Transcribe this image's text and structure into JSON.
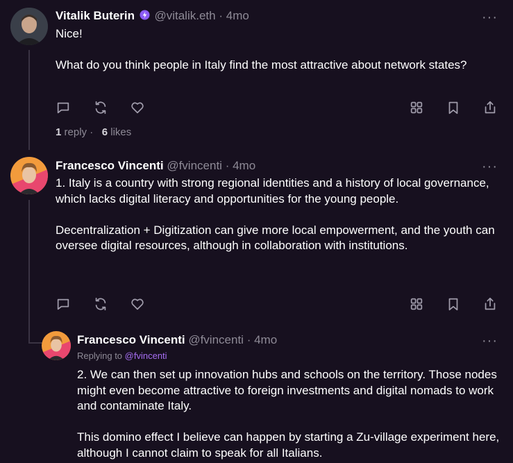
{
  "posts": [
    {
      "author": "Vitalik Buterin",
      "handle": "@vitalik.eth",
      "time": "4mo",
      "paragraphs": [
        "Nice!",
        "What do you think people in Italy find the most attractive about network states?"
      ],
      "stats": {
        "replies": "1",
        "reply_label": "reply",
        "likes": "6",
        "likes_label": "likes",
        "sep": "·"
      },
      "verified_color": "#8b5cf6"
    },
    {
      "author": "Francesco Vincenti",
      "handle": "@fvincenti",
      "time": "4mo",
      "paragraphs": [
        "1. Italy is a country with strong regional identities and a history of local governance, which lacks digital literacy and opportunities for the young people.",
        "Decentralization + Digitization can give more local empowerment, and the youth can oversee digital resources, although in collaboration with institutions."
      ]
    },
    {
      "author": "Francesco Vincenti",
      "handle": "@fvincenti",
      "time": "4mo",
      "replying_prefix": "Replying to",
      "replying_to": "@fvincenti",
      "paragraphs": [
        "2. We can then set up innovation hubs and schools on the territory. Those nodes might even become attractive to foreign investments and digital nomads to work and contaminate Italy.",
        "This domino effect I believe can happen by starting a Zu-village experiment here, although I cannot claim to speak for all Italians."
      ]
    }
  ],
  "dot_separator": "·",
  "more_glyph": "···",
  "colors": {
    "background": "#17101f",
    "muted": "#8e8a96",
    "accent": "#a66ef2"
  }
}
